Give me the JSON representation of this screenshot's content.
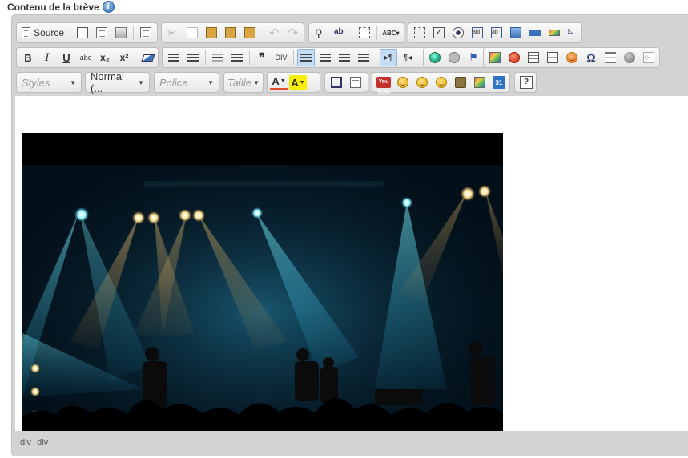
{
  "field": {
    "label": "Contenu de la brève",
    "info_icon": "info-icon"
  },
  "toolbar": {
    "source_label": "Source",
    "styles_placeholder": "Styles",
    "format_value": "Normal (...",
    "font_placeholder": "Police",
    "size_placeholder": "Taille",
    "youtube_label": "You Tube",
    "calendar_label": "31",
    "help_label": "?",
    "bold": "B",
    "italic": "I",
    "underline": "U",
    "strike": "abc",
    "subscript": "x₂",
    "superscript": "x²"
  },
  "statusbar": {
    "path": [
      "div",
      "div"
    ]
  },
  "colors": {
    "active_button": "#c4dcf4",
    "toolbar_bg": "#d3d3d3"
  }
}
